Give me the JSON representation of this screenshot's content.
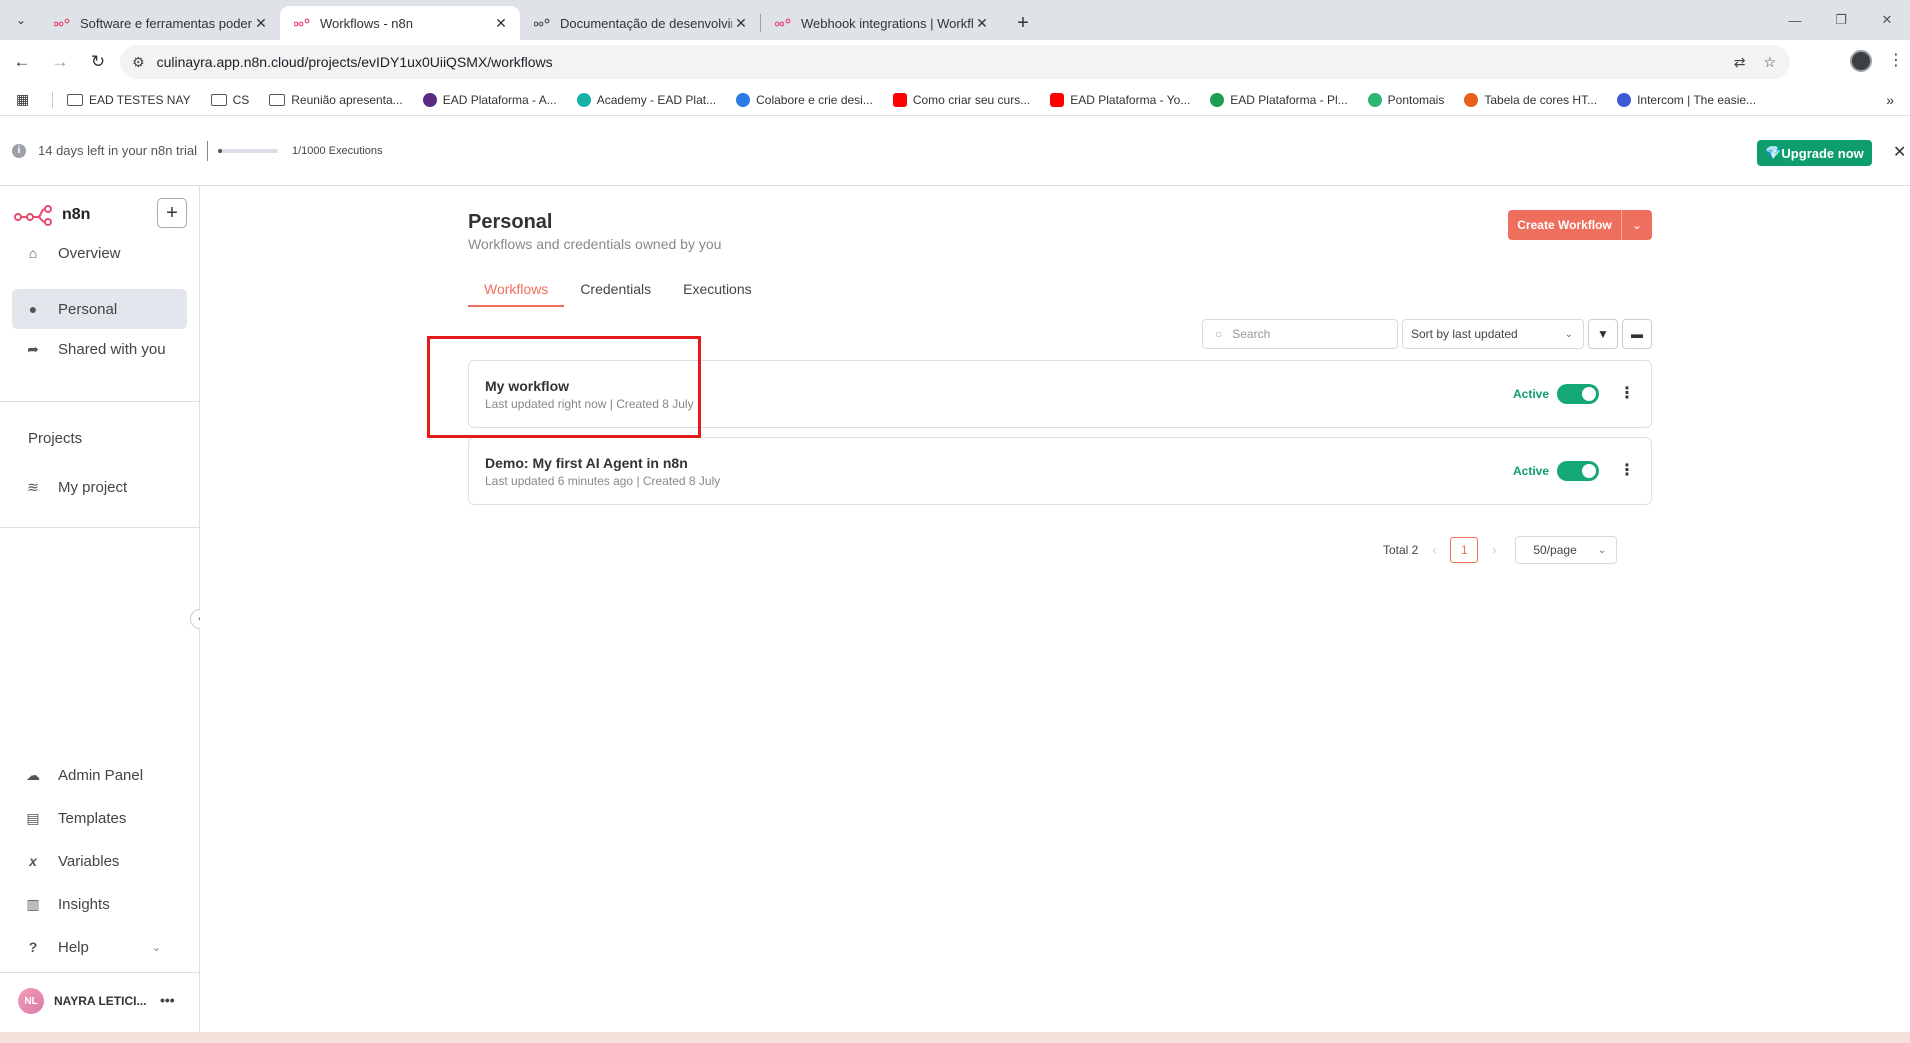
{
  "browser": {
    "tabs": [
      {
        "title": "Software e ferramentas poderosas",
        "active": false
      },
      {
        "title": "Workflows - n8n",
        "active": true
      },
      {
        "title": "Documentação de desenvolvimento",
        "active": false
      },
      {
        "title": "Webhook integrations | Workflow",
        "active": false
      }
    ],
    "url": "culinayra.app.n8n.cloud/projects/evIDY1ux0UiiQSMX/workflows",
    "bookmarks": [
      {
        "label": "EAD TESTES NAY",
        "icon": "folder-icon"
      },
      {
        "label": "CS",
        "icon": "folder-icon"
      },
      {
        "label": "Reunião apresenta...",
        "icon": "folder-icon"
      },
      {
        "label": "EAD Plataforma - A...",
        "icon": "site-icon",
        "color": "#5b2a86"
      },
      {
        "label": "Academy - EAD Plat...",
        "icon": "site-icon",
        "color": "#17b3a8"
      },
      {
        "label": "Colabore e crie desi...",
        "icon": "site-icon",
        "color": "#2e7be6"
      },
      {
        "label": "Como criar seu curs...",
        "icon": "youtube-icon",
        "color": "#ff0000"
      },
      {
        "label": "EAD Plataforma - Yo...",
        "icon": "youtube-icon",
        "color": "#ff0000"
      },
      {
        "label": "EAD Plataforma - Pl...",
        "icon": "sheets-icon",
        "color": "#1f9d55"
      },
      {
        "label": "Pontomais",
        "icon": "site-icon",
        "color": "#2bb673"
      },
      {
        "label": "Tabela de cores HT...",
        "icon": "site-icon",
        "color": "#e8601c"
      },
      {
        "label": "Intercom | The easie...",
        "icon": "site-icon",
        "color": "#3c5ad8"
      }
    ]
  },
  "banner": {
    "trial_text": "14 days left in your n8n trial",
    "executions_text": "1/1000 Executions",
    "executions_fraction": 0.001,
    "upgrade_label": "Upgrade now"
  },
  "sidebar": {
    "brand": "n8n",
    "nav": [
      {
        "label": "Overview",
        "icon": "home-icon"
      },
      {
        "label": "Personal",
        "icon": "user-icon"
      },
      {
        "label": "Shared with you",
        "icon": "share-icon"
      }
    ],
    "projects_label": "Projects",
    "projects": [
      {
        "label": "My project",
        "icon": "layers-icon"
      }
    ],
    "bottom": [
      {
        "label": "Admin Panel",
        "icon": "cloud-icon"
      },
      {
        "label": "Templates",
        "icon": "box-icon"
      },
      {
        "label": "Variables",
        "icon": "variable-icon"
      },
      {
        "label": "Insights",
        "icon": "chart-icon"
      },
      {
        "label": "Help",
        "icon": "question-icon"
      }
    ],
    "user": {
      "initials": "NL",
      "name": "NAYRA LETICI..."
    }
  },
  "main": {
    "title": "Personal",
    "subtitle": "Workflows and credentials owned by you",
    "create_label": "Create Workflow",
    "tabs": [
      "Workflows",
      "Credentials",
      "Executions"
    ],
    "search_placeholder": "Search",
    "sort_label": "Sort by last updated",
    "workflows": [
      {
        "name": "My workflow",
        "meta": "Last updated right now | Created 8 July",
        "status": "Active"
      },
      {
        "name": "Demo: My first AI Agent in n8n",
        "meta": "Last updated 6 minutes ago | Created 8 July",
        "status": "Active"
      }
    ],
    "pagination": {
      "total": "Total 2",
      "current": "1",
      "page_size": "50/page"
    }
  },
  "colors": {
    "accent": "#ef6f5e",
    "success": "#0e9e6e",
    "highlight": "#e31b1b"
  }
}
